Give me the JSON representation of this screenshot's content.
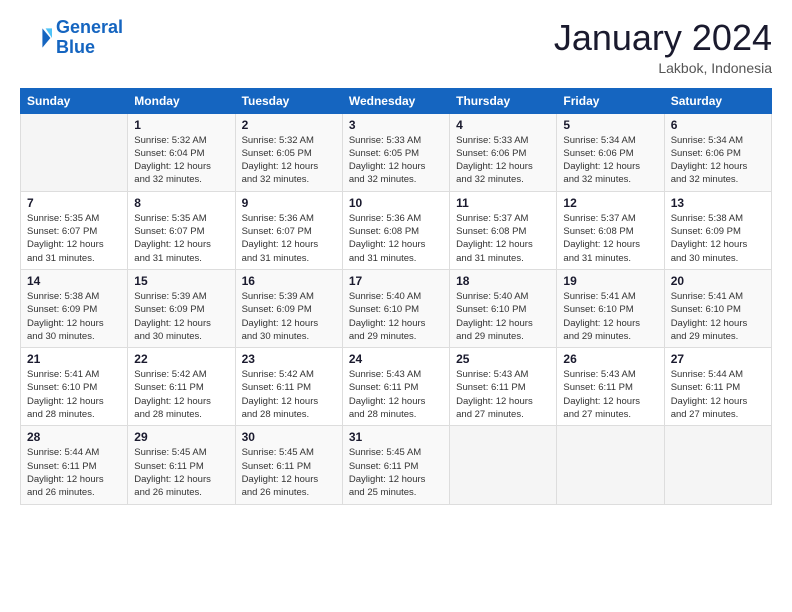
{
  "logo": {
    "line1": "General",
    "line2": "Blue"
  },
  "title": "January 2024",
  "location": "Lakbok, Indonesia",
  "weekdays": [
    "Sunday",
    "Monday",
    "Tuesday",
    "Wednesday",
    "Thursday",
    "Friday",
    "Saturday"
  ],
  "weeks": [
    [
      {
        "day": null
      },
      {
        "day": "1",
        "sunrise": "5:32 AM",
        "sunset": "6:04 PM",
        "daylight": "12 hours and 32 minutes."
      },
      {
        "day": "2",
        "sunrise": "5:32 AM",
        "sunset": "6:05 PM",
        "daylight": "12 hours and 32 minutes."
      },
      {
        "day": "3",
        "sunrise": "5:33 AM",
        "sunset": "6:05 PM",
        "daylight": "12 hours and 32 minutes."
      },
      {
        "day": "4",
        "sunrise": "5:33 AM",
        "sunset": "6:06 PM",
        "daylight": "12 hours and 32 minutes."
      },
      {
        "day": "5",
        "sunrise": "5:34 AM",
        "sunset": "6:06 PM",
        "daylight": "12 hours and 32 minutes."
      },
      {
        "day": "6",
        "sunrise": "5:34 AM",
        "sunset": "6:06 PM",
        "daylight": "12 hours and 32 minutes."
      }
    ],
    [
      {
        "day": "7",
        "sunrise": "5:35 AM",
        "sunset": "6:07 PM",
        "daylight": "12 hours and 31 minutes."
      },
      {
        "day": "8",
        "sunrise": "5:35 AM",
        "sunset": "6:07 PM",
        "daylight": "12 hours and 31 minutes."
      },
      {
        "day": "9",
        "sunrise": "5:36 AM",
        "sunset": "6:07 PM",
        "daylight": "12 hours and 31 minutes."
      },
      {
        "day": "10",
        "sunrise": "5:36 AM",
        "sunset": "6:08 PM",
        "daylight": "12 hours and 31 minutes."
      },
      {
        "day": "11",
        "sunrise": "5:37 AM",
        "sunset": "6:08 PM",
        "daylight": "12 hours and 31 minutes."
      },
      {
        "day": "12",
        "sunrise": "5:37 AM",
        "sunset": "6:08 PM",
        "daylight": "12 hours and 31 minutes."
      },
      {
        "day": "13",
        "sunrise": "5:38 AM",
        "sunset": "6:09 PM",
        "daylight": "12 hours and 30 minutes."
      }
    ],
    [
      {
        "day": "14",
        "sunrise": "5:38 AM",
        "sunset": "6:09 PM",
        "daylight": "12 hours and 30 minutes."
      },
      {
        "day": "15",
        "sunrise": "5:39 AM",
        "sunset": "6:09 PM",
        "daylight": "12 hours and 30 minutes."
      },
      {
        "day": "16",
        "sunrise": "5:39 AM",
        "sunset": "6:09 PM",
        "daylight": "12 hours and 30 minutes."
      },
      {
        "day": "17",
        "sunrise": "5:40 AM",
        "sunset": "6:10 PM",
        "daylight": "12 hours and 29 minutes."
      },
      {
        "day": "18",
        "sunrise": "5:40 AM",
        "sunset": "6:10 PM",
        "daylight": "12 hours and 29 minutes."
      },
      {
        "day": "19",
        "sunrise": "5:41 AM",
        "sunset": "6:10 PM",
        "daylight": "12 hours and 29 minutes."
      },
      {
        "day": "20",
        "sunrise": "5:41 AM",
        "sunset": "6:10 PM",
        "daylight": "12 hours and 29 minutes."
      }
    ],
    [
      {
        "day": "21",
        "sunrise": "5:41 AM",
        "sunset": "6:10 PM",
        "daylight": "12 hours and 28 minutes."
      },
      {
        "day": "22",
        "sunrise": "5:42 AM",
        "sunset": "6:11 PM",
        "daylight": "12 hours and 28 minutes."
      },
      {
        "day": "23",
        "sunrise": "5:42 AM",
        "sunset": "6:11 PM",
        "daylight": "12 hours and 28 minutes."
      },
      {
        "day": "24",
        "sunrise": "5:43 AM",
        "sunset": "6:11 PM",
        "daylight": "12 hours and 28 minutes."
      },
      {
        "day": "25",
        "sunrise": "5:43 AM",
        "sunset": "6:11 PM",
        "daylight": "12 hours and 27 minutes."
      },
      {
        "day": "26",
        "sunrise": "5:43 AM",
        "sunset": "6:11 PM",
        "daylight": "12 hours and 27 minutes."
      },
      {
        "day": "27",
        "sunrise": "5:44 AM",
        "sunset": "6:11 PM",
        "daylight": "12 hours and 27 minutes."
      }
    ],
    [
      {
        "day": "28",
        "sunrise": "5:44 AM",
        "sunset": "6:11 PM",
        "daylight": "12 hours and 26 minutes."
      },
      {
        "day": "29",
        "sunrise": "5:45 AM",
        "sunset": "6:11 PM",
        "daylight": "12 hours and 26 minutes."
      },
      {
        "day": "30",
        "sunrise": "5:45 AM",
        "sunset": "6:11 PM",
        "daylight": "12 hours and 26 minutes."
      },
      {
        "day": "31",
        "sunrise": "5:45 AM",
        "sunset": "6:11 PM",
        "daylight": "12 hours and 25 minutes."
      },
      {
        "day": null
      },
      {
        "day": null
      },
      {
        "day": null
      }
    ]
  ]
}
